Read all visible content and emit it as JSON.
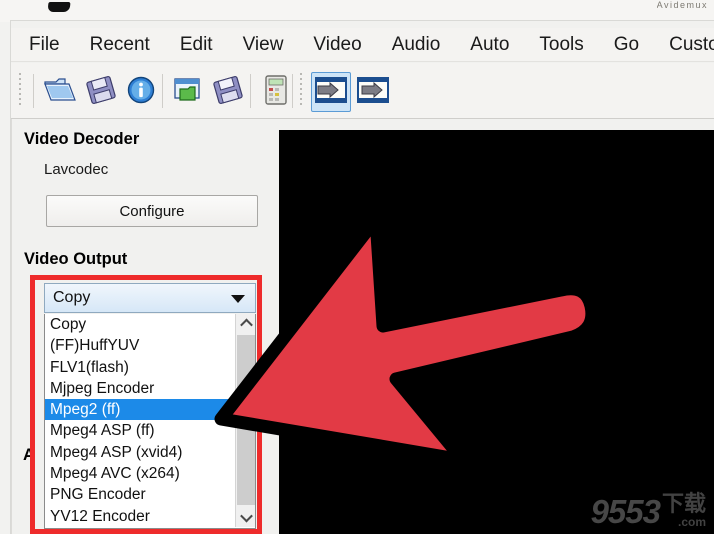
{
  "window": {
    "title_fragment": "Avidemux",
    "app_icon": "video-clapper-icon"
  },
  "menubar": {
    "items": [
      {
        "label": "File",
        "name": "menu-file"
      },
      {
        "label": "Recent",
        "name": "menu-recent"
      },
      {
        "label": "Edit",
        "name": "menu-edit"
      },
      {
        "label": "View",
        "name": "menu-view"
      },
      {
        "label": "Video",
        "name": "menu-video"
      },
      {
        "label": "Audio",
        "name": "menu-audio"
      },
      {
        "label": "Auto",
        "name": "menu-auto"
      },
      {
        "label": "Tools",
        "name": "menu-tools"
      },
      {
        "label": "Go",
        "name": "menu-go"
      },
      {
        "label": "Custom",
        "name": "menu-custom"
      }
    ]
  },
  "toolbar": {
    "buttons": [
      {
        "icon": "open-folder-icon",
        "name": "toolbar-open"
      },
      {
        "icon": "save-floppy-icon",
        "name": "toolbar-save"
      },
      {
        "icon": "info-circle-icon",
        "name": "toolbar-info"
      },
      {
        "icon": "open-project-icon",
        "name": "toolbar-open-project"
      },
      {
        "icon": "save-project-icon",
        "name": "toolbar-save-project"
      },
      {
        "icon": "calculator-icon",
        "name": "toolbar-calculator"
      },
      {
        "icon": "mark-in-icon",
        "name": "toolbar-mark-in"
      },
      {
        "icon": "mark-out-icon",
        "name": "toolbar-mark-out"
      }
    ]
  },
  "left_panel": {
    "video_decoder": {
      "heading": "Video Decoder",
      "value": "Lavcodec",
      "configure_label": "Configure"
    },
    "video_output": {
      "heading": "Video Output",
      "selected": "Copy",
      "options": [
        "Copy",
        "(FF)HuffYUV",
        "FLV1(flash)",
        "Mjpeg Encoder",
        "Mpeg2 (ff)",
        "Mpeg4 ASP (ff)",
        "Mpeg4 ASP (xvid4)",
        "Mpeg4 AVC (x264)",
        "PNG Encoder",
        "YV12 Encoder"
      ],
      "highlighted_option": "Mpeg2 (ff)",
      "highlighted_index": 4
    },
    "audio_heading_partial": "A"
  },
  "video_preview": {
    "background_color": "#000000",
    "watermark_number": "9553",
    "watermark_cn": "下载",
    "watermark_com": ".com"
  },
  "annotations": {
    "highlight_box_color": "#ee2b2b",
    "arrow_fill_color": "#e23a45",
    "arrow_outline_color": "#000000",
    "arrow_direction": "left"
  },
  "colors": {
    "selection_blue": "#1c8ae8",
    "combo_border": "#8fa9bf",
    "panel_bg": "#f1f1ef",
    "toolbar_selected": "#cde4f7"
  }
}
